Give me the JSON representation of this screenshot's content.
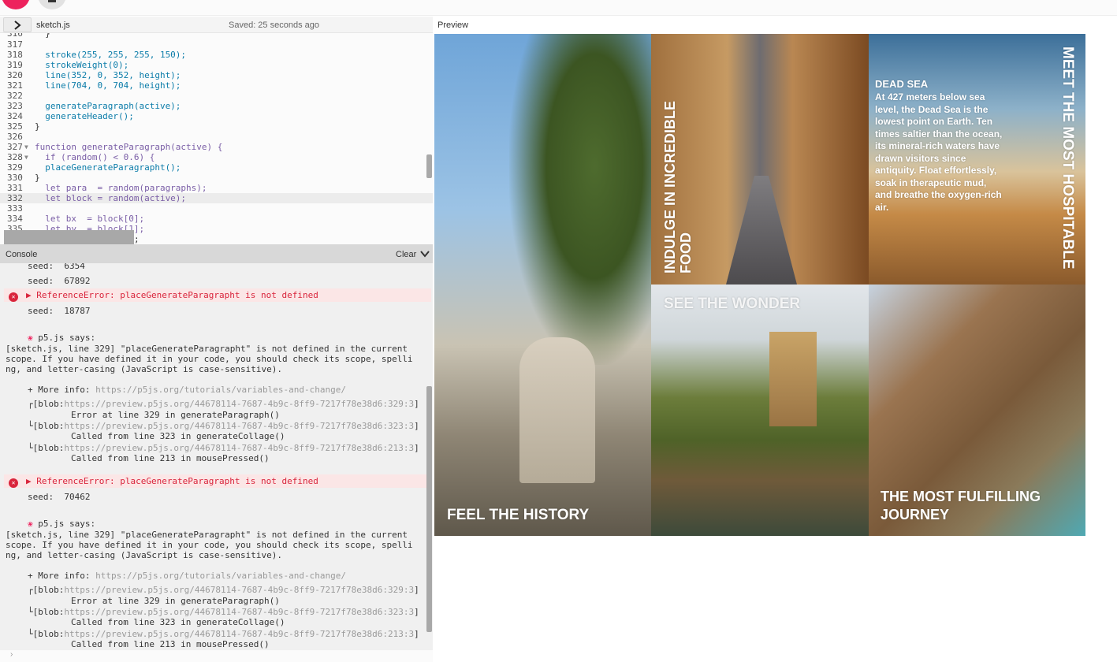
{
  "toolbar": {
    "play_icon": "play-icon",
    "stop_icon": "stop-icon"
  },
  "editor": {
    "file_name": "sketch.js",
    "saved_status": "Saved: 25 seconds ago",
    "lines": [
      {
        "num": "316",
        "text": "  }"
      },
      {
        "num": "317",
        "text": ""
      },
      {
        "num": "318",
        "text": "  stroke(255, 255, 255, 150);"
      },
      {
        "num": "319",
        "text": "  strokeWeight(0);"
      },
      {
        "num": "320",
        "text": "  line(352, 0, 352, height);"
      },
      {
        "num": "321",
        "text": "  line(704, 0, 704, height);"
      },
      {
        "num": "322",
        "text": ""
      },
      {
        "num": "323",
        "text": "  generateParagraph(active);"
      },
      {
        "num": "324",
        "text": "  generateHeader();"
      },
      {
        "num": "325",
        "text": "}"
      },
      {
        "num": "326",
        "text": ""
      },
      {
        "num": "327",
        "text": "function generateParagraph(active) {"
      },
      {
        "num": "328",
        "text": "  if (random() < 0.6) {"
      },
      {
        "num": "329",
        "text": "  placeGenerateParagrapht();"
      },
      {
        "num": "330",
        "text": "}"
      },
      {
        "num": "331",
        "text": "  let para  = random(paragraphs);"
      },
      {
        "num": "332",
        "text": "  let block = random(active);"
      },
      {
        "num": "333",
        "text": ""
      },
      {
        "num": "334",
        "text": "  let bx  = block[0];"
      },
      {
        "num": "335",
        "text": "  let by  = block[1];"
      }
    ],
    "trailing_fragment": ";"
  },
  "console": {
    "title": "Console",
    "clear_label": "Clear",
    "seed_1": "seed:  6354",
    "seed_2": "seed:  67892",
    "error_1": "ReferenceError: placeGenerateParagrapht is not defined",
    "seed_3": "seed:  18787",
    "p5_says_1": "p5.js says:",
    "msg_1a": "[sketch.js, line 329] \"placeGenerateParagrapht\" is not defined in the current",
    "msg_1b": "scope. If you have defined it in your code, you should check its scope, spelli",
    "msg_1c": "ng, and letter-casing (JavaScript is case-sensitive).",
    "more_info_label": "+ More info:",
    "more_info_url": "https://p5js.org/tutorials/variables-and-change/",
    "blob_1": "https://preview.p5js.org/44678114-7687-4b9c-8ff9-7217f78e38d6:329:3",
    "blob_2": "https://preview.p5js.org/44678114-7687-4b9c-8ff9-7217f78e38d6:323:3",
    "blob_3": "https://preview.p5js.org/44678114-7687-4b9c-8ff9-7217f78e38d6:213:3",
    "trace_1": "Error at line 329 in generateParagraph()",
    "trace_2": "Called from line 323 in generateCollage()",
    "trace_3": "Called from line 213 in mousePressed()",
    "error_2": "ReferenceError: placeGenerateParagrapht is not defined",
    "seed_4": "seed:  70462",
    "p5_says_2": "p5.js says:",
    "msg_2a": "[sketch.js, line 329] \"placeGenerateParagrapht\" is not defined in the current",
    "msg_2b": "scope. If you have defined it in your code, you should check its scope, spelli",
    "msg_2c": "ng, and letter-casing (JavaScript is case-sensitive).",
    "blob_prefix_top": "┌[blob:",
    "blob_prefix_mid": "└[blob:",
    "blob_suffix": "]",
    "prompt": "›"
  },
  "preview": {
    "label": "Preview",
    "panels": {
      "history": "FEEL THE HISTORY",
      "food": "INDULGE IN INCREDIBLE FOOD",
      "dead_sea_title": "DEAD SEA",
      "dead_sea_body": "At 427 meters below sea level, the Dead Sea is the lowest point on Earth. Ten times saltier than the ocean, its mineral-rich waters have drawn visitors since antiquity. Float effortlessly, soak in therapeutic mud, and breathe the oxygen-rich air.",
      "hospitable": "MEET THE MOST HOSPITABLE",
      "wonder": "SEE THE WONDER",
      "journey": "THE MOST FULFILLING JOURNEY"
    }
  },
  "colors": {
    "accent": "#ed225d",
    "error": "#d9253c",
    "error_bg": "#fbe6e6"
  }
}
